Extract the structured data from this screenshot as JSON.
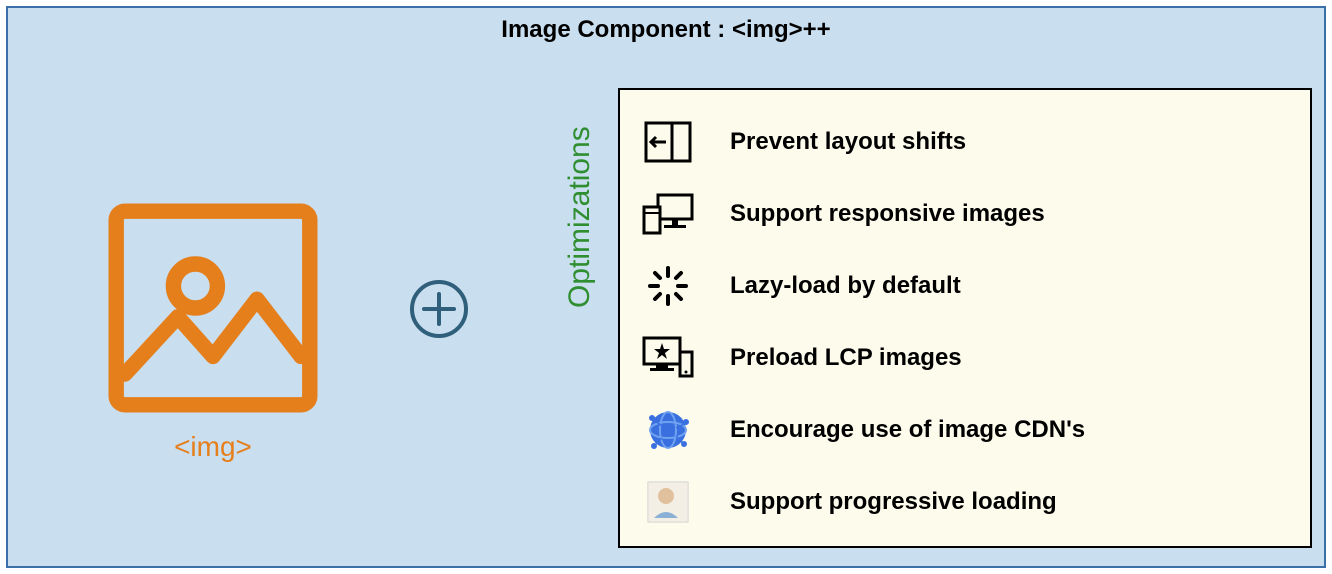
{
  "title": "Image Component : <img>++",
  "image_label": "<img>",
  "plus_symbol": "+",
  "optimizations_label": "Optimizations",
  "optimizations": [
    {
      "icon": "layout-shift-icon",
      "text": "Prevent layout shifts"
    },
    {
      "icon": "responsive-icon",
      "text": "Support responsive images"
    },
    {
      "icon": "lazy-load-icon",
      "text": "Lazy-load by default"
    },
    {
      "icon": "preload-icon",
      "text": "Preload LCP images"
    },
    {
      "icon": "cdn-icon",
      "text": "Encourage use of image CDN's"
    },
    {
      "icon": "progressive-icon",
      "text": "Support progressive loading"
    }
  ]
}
